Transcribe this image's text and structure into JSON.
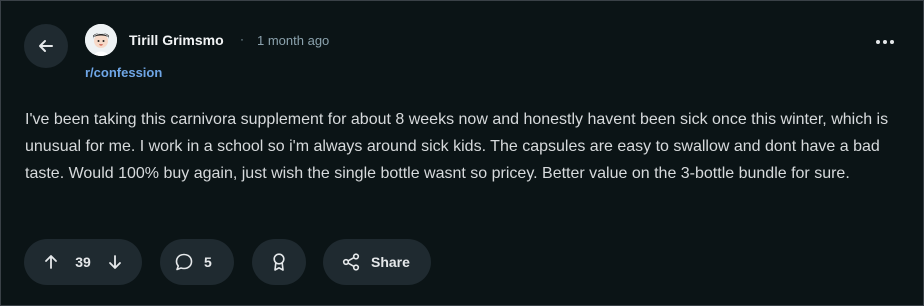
{
  "post": {
    "author": "Tirill Grimsmo",
    "separator": "·",
    "time": "1 month ago",
    "subreddit": "r/confession",
    "body": "I've been taking this carnivora supplement for about 8 weeks now and honestly havent been sick once this winter, which is unusual for me. I work in a school so i'm always around sick kids. The capsules are easy to swallow and dont have a bad taste. Would 100% buy again, just wish the single bottle wasnt so pricey. Better value on the 3-bottle bundle for sure."
  },
  "actions": {
    "votes": "39",
    "comments": "5",
    "share_label": "Share"
  },
  "icons": {
    "back": "arrow-left-icon",
    "more": "more-options-icon",
    "upvote": "arrow-up-icon",
    "downvote": "arrow-down-icon",
    "comment": "speech-bubble-icon",
    "award": "award-ribbon-icon",
    "share": "share-icon"
  },
  "colors": {
    "background": "#0b1416",
    "pill": "#1f2a30",
    "subreddit_link": "#6fa6e6",
    "muted_text": "#8ba2ad"
  }
}
